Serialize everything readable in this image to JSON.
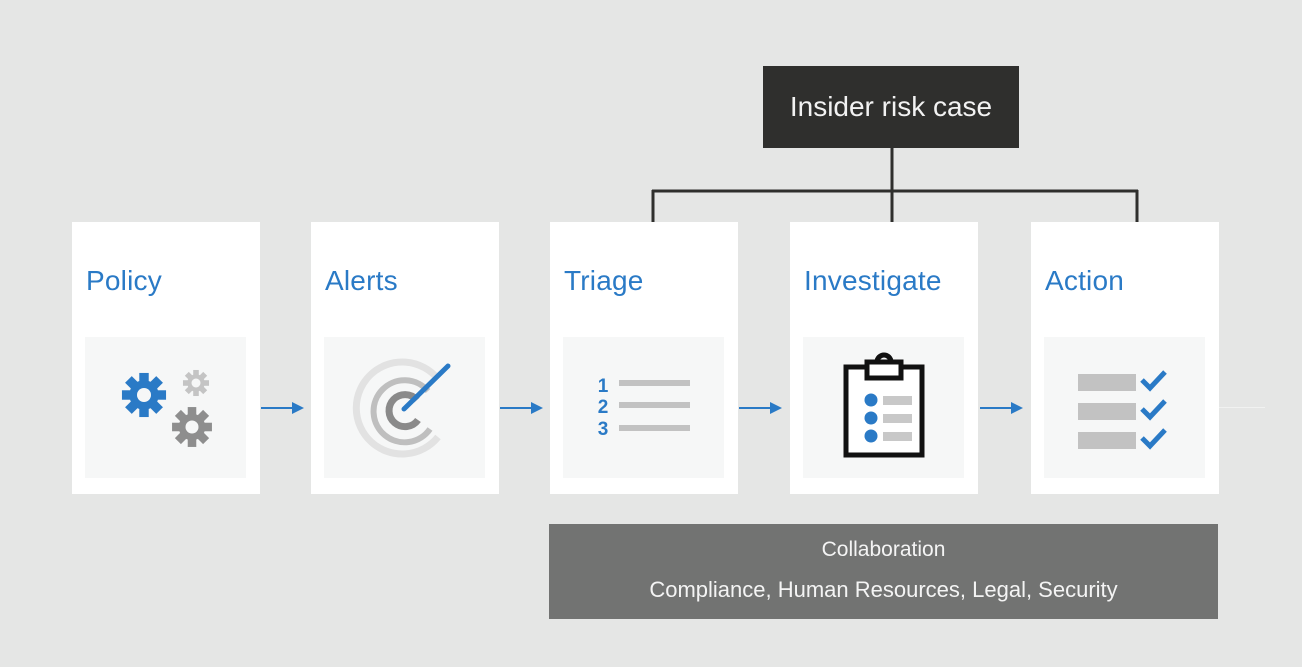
{
  "case_box": {
    "label": "Insider risk case"
  },
  "stages": [
    {
      "id": "policy",
      "title": "Policy",
      "icon": "gears-icon"
    },
    {
      "id": "alerts",
      "title": "Alerts",
      "icon": "target-radar-icon"
    },
    {
      "id": "triage",
      "title": "Triage",
      "icon": "numbered-list-icon",
      "numbers": [
        "1",
        "2",
        "3"
      ]
    },
    {
      "id": "investigate",
      "title": "Investigate",
      "icon": "clipboard-checklist-icon"
    },
    {
      "id": "action",
      "title": "Action",
      "icon": "checklist-done-icon"
    }
  ],
  "case_connects_to": [
    "Triage",
    "Investigate",
    "Action"
  ],
  "collaboration": {
    "title": "Collaboration",
    "participants": "Compliance, Human Resources, Legal, Security"
  },
  "colors": {
    "background": "#e5e6e5",
    "accent_blue": "#2a7ac6",
    "case_box": "#2f2f2d",
    "collaboration_box": "#727372",
    "icon_gray": "#c2c2c2",
    "icon_dark_gray": "#8a8a8a"
  }
}
